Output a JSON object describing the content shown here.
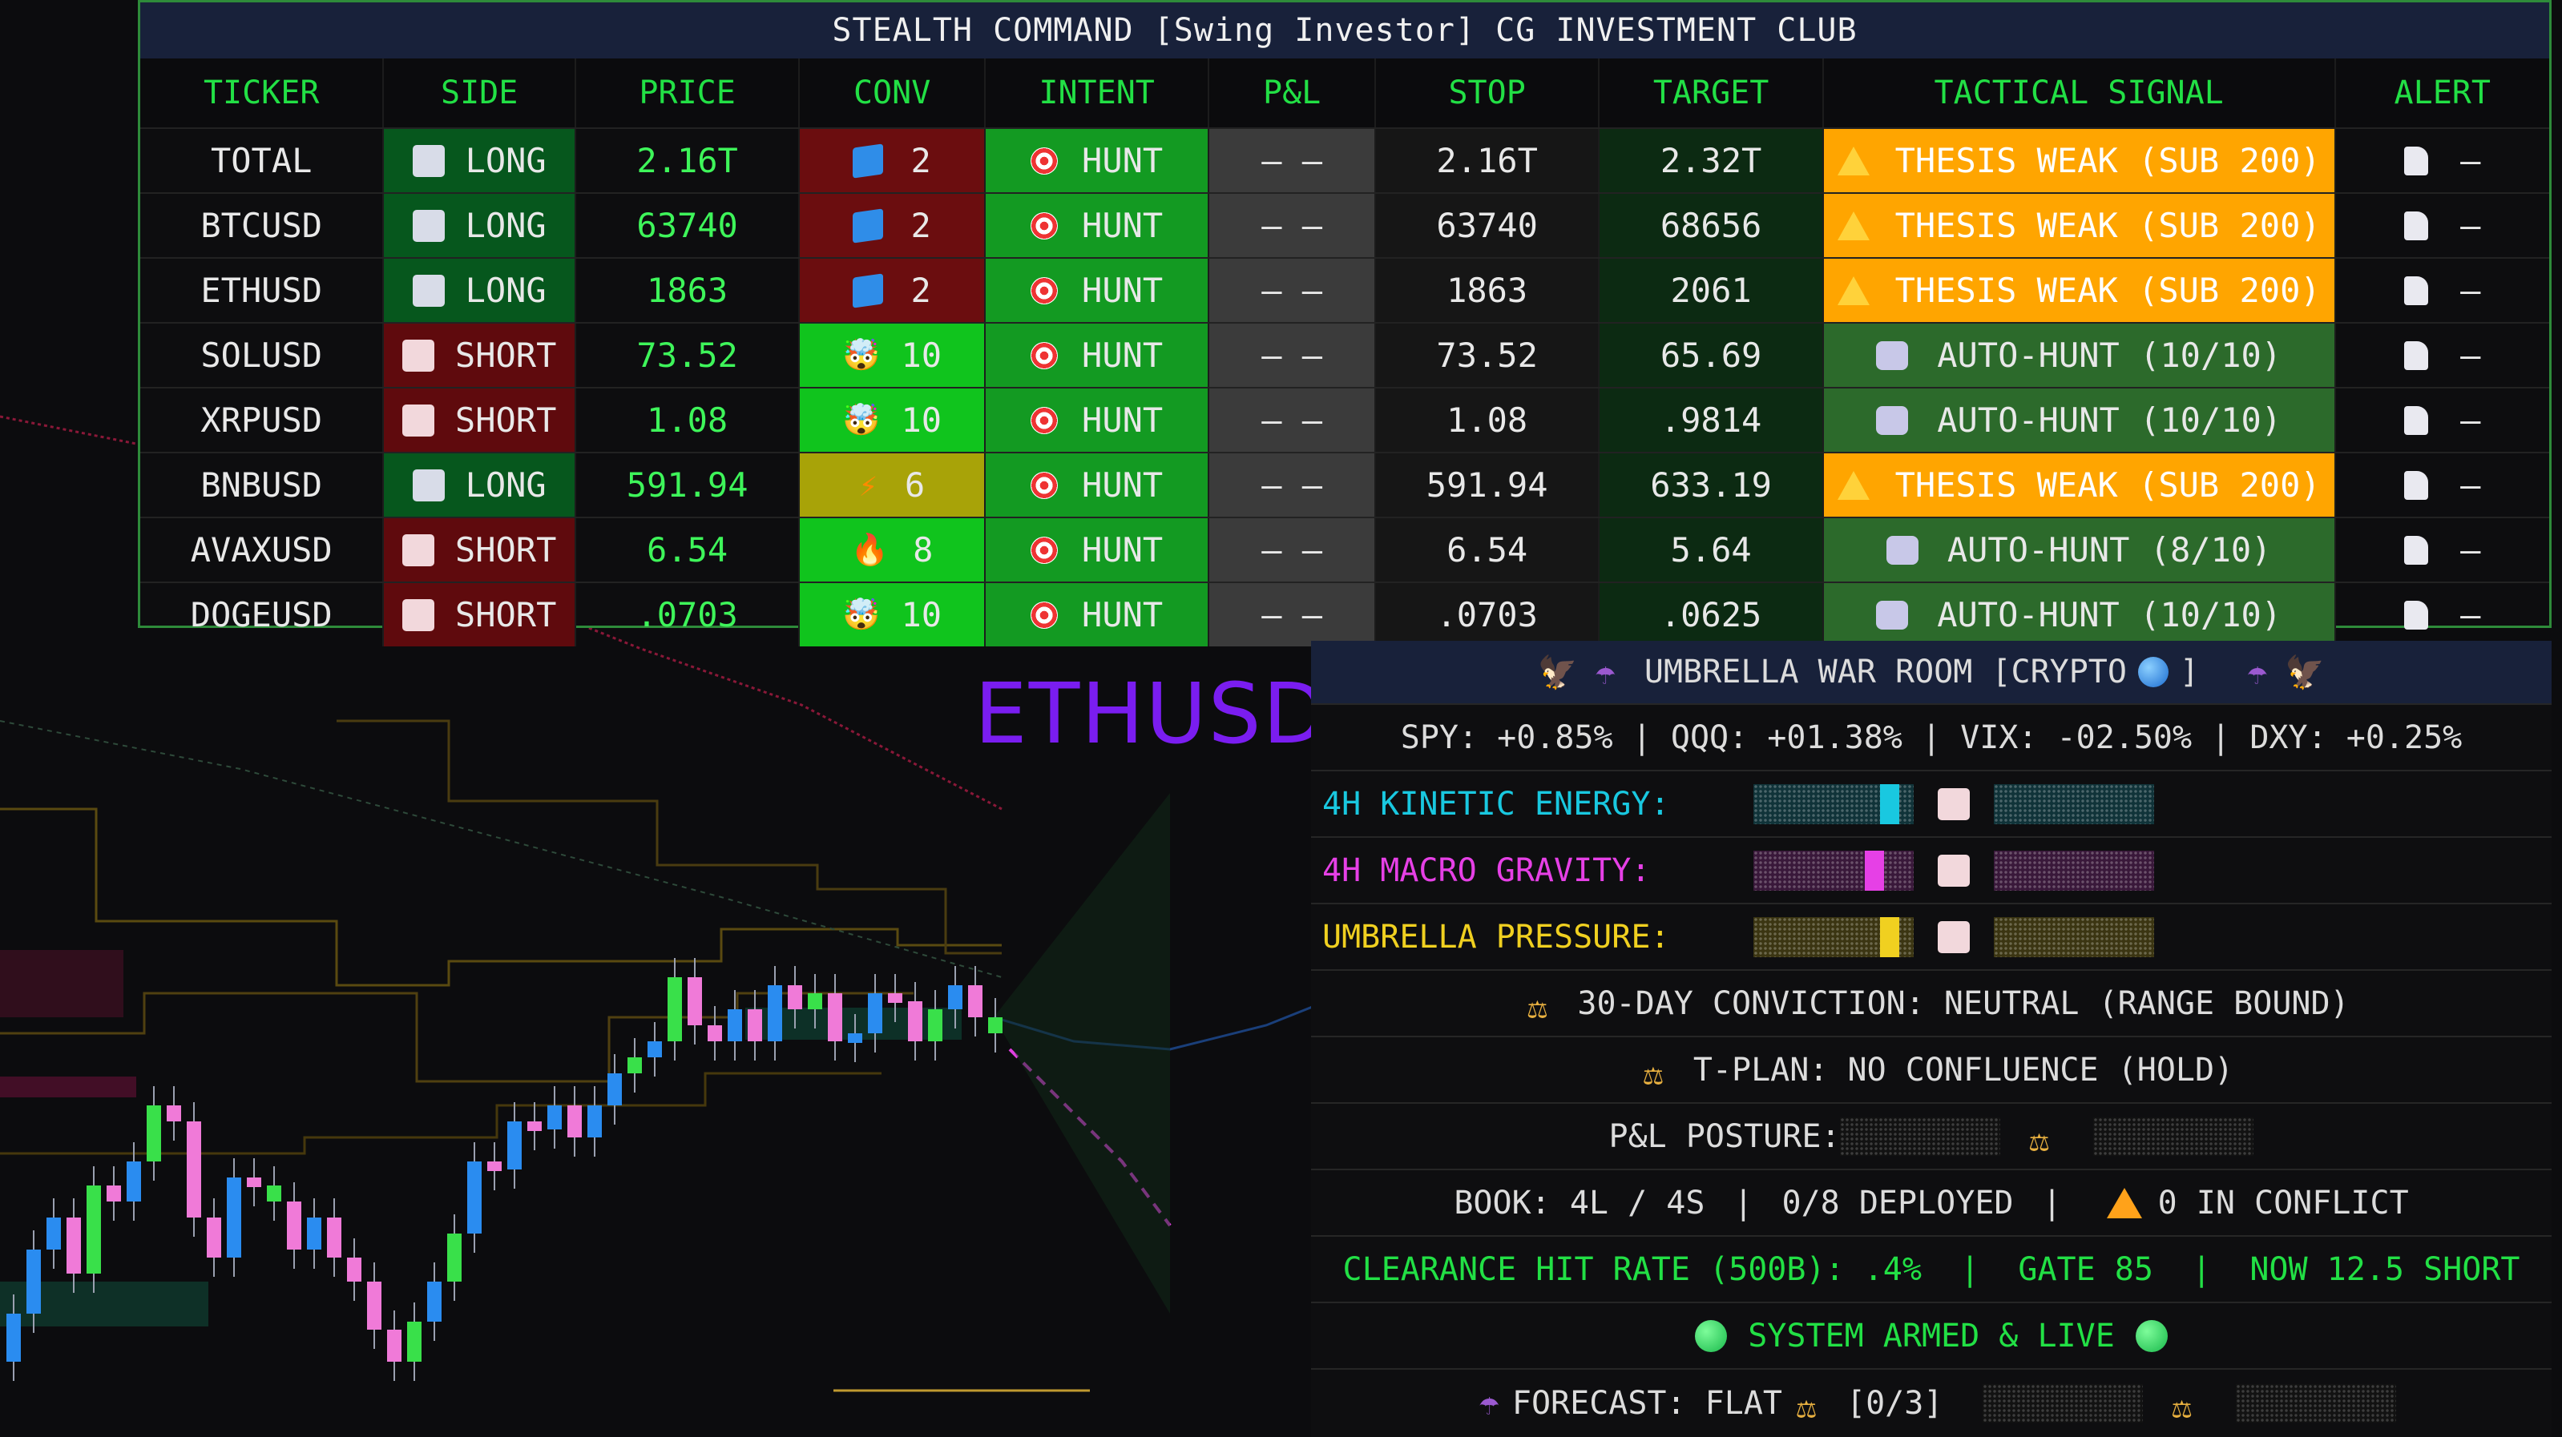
{
  "table": {
    "title": "STEALTH COMMAND [Swing Investor] CG INVESTMENT CLUB",
    "headers": [
      "TICKER",
      "SIDE",
      "PRICE",
      "CONV",
      "INTENT",
      "P&L",
      "STOP",
      "TARGET",
      "TACTICAL SIGNAL",
      "ALERT"
    ],
    "rows": [
      {
        "ticker": "TOTAL",
        "side": "LONG",
        "price": "2.16T",
        "conv": "2",
        "conv_icon": "ice-cube-icon",
        "intent": "HUNT",
        "pl": "— —",
        "stop": "2.16T",
        "target": "2.32T",
        "signal": "THESIS WEAK (SUB 200)",
        "signal_type": "warning",
        "alert": "—"
      },
      {
        "ticker": "BTCUSD",
        "side": "LONG",
        "price": "63740",
        "conv": "2",
        "conv_icon": "ice-cube-icon",
        "intent": "HUNT",
        "pl": "— —",
        "stop": "63740",
        "target": "68656",
        "signal": "THESIS WEAK (SUB 200)",
        "signal_type": "warning",
        "alert": "—"
      },
      {
        "ticker": "ETHUSD",
        "side": "LONG",
        "price": "1863",
        "conv": "2",
        "conv_icon": "ice-cube-icon",
        "intent": "HUNT",
        "pl": "— —",
        "stop": "1863",
        "target": "2061",
        "signal": "THESIS WEAK (SUB 200)",
        "signal_type": "warning",
        "alert": "—"
      },
      {
        "ticker": "SOLUSD",
        "side": "SHORT",
        "price": "73.52",
        "conv": "10",
        "conv_icon": "exploding-head-icon",
        "intent": "HUNT",
        "pl": "— —",
        "stop": "73.52",
        "target": "65.69",
        "signal": "AUTO-HUNT (10/10)",
        "signal_type": "auto",
        "alert": "—"
      },
      {
        "ticker": "XRPUSD",
        "side": "SHORT",
        "price": "1.08",
        "conv": "10",
        "conv_icon": "exploding-head-icon",
        "intent": "HUNT",
        "pl": "— —",
        "stop": "1.08",
        "target": ".9814",
        "signal": "AUTO-HUNT (10/10)",
        "signal_type": "auto",
        "alert": "—"
      },
      {
        "ticker": "BNBUSD",
        "side": "LONG",
        "price": "591.94",
        "conv": "6",
        "conv_icon": "lightning-icon",
        "intent": "HUNT",
        "pl": "— —",
        "stop": "591.94",
        "target": "633.19",
        "signal": "THESIS WEAK (SUB 200)",
        "signal_type": "warning",
        "alert": "—"
      },
      {
        "ticker": "AVAXUSD",
        "side": "SHORT",
        "price": "6.54",
        "conv": "8",
        "conv_icon": "fire-icon",
        "intent": "HUNT",
        "pl": "— —",
        "stop": "6.54",
        "target": "5.64",
        "signal": "AUTO-HUNT (8/10)",
        "signal_type": "auto",
        "alert": "—"
      },
      {
        "ticker": "DOGEUSD",
        "side": "SHORT",
        "price": ".0703",
        "conv": "10",
        "conv_icon": "exploding-head-icon",
        "intent": "HUNT",
        "pl": "— —",
        "stop": ".0703",
        "target": ".0625",
        "signal": "AUTO-HUNT (10/10)",
        "signal_type": "auto",
        "alert": "—"
      }
    ]
  },
  "symbol": "ETHUSD",
  "war_room": {
    "title": "UMBRELLA WAR ROOM [CRYPTO",
    "title_end": "]",
    "macro": "SPY: +0.85% | QQQ: +01.38% | VIX: -02.50% | DXY: +0.25%",
    "gauges": [
      {
        "label": "4H KINETIC ENERGY:",
        "color": "#19c8e0",
        "level": 0.85
      },
      {
        "label": "4H MACRO GRAVITY:",
        "color": "#e640e6",
        "level": 0.75
      },
      {
        "label": "UMBRELLA PRESSURE:",
        "color": "#f0d020",
        "level": 0.85
      }
    ],
    "conviction": "30-DAY CONVICTION: NEUTRAL (RANGE BOUND)",
    "tplan": "T-PLAN: NO CONFLUENCE (HOLD)",
    "pl_posture": "P&L POSTURE:",
    "book_a": "BOOK: 4L / 4S",
    "book_sep1": "|",
    "book_b": "0/8 DEPLOYED",
    "book_sep2": "|",
    "book_c": "0 IN CONFLICT",
    "clearance": "CLEARANCE HIT RATE (500B): .4%  |  GATE 85  |  NOW 12.5 SHORT",
    "system": "SYSTEM ARMED & LIVE",
    "forecast": "FORECAST: FLAT",
    "forecast_count": "[0/3]"
  },
  "colors": {
    "accent_green": "#22e045",
    "long_bg": "#06571d",
    "short_bg": "#5f0a0d",
    "warning": "#ffa500",
    "symbol": "#7a1df0",
    "candle_up": "#2a8cf0",
    "candle_down": "#f07ad8"
  }
}
